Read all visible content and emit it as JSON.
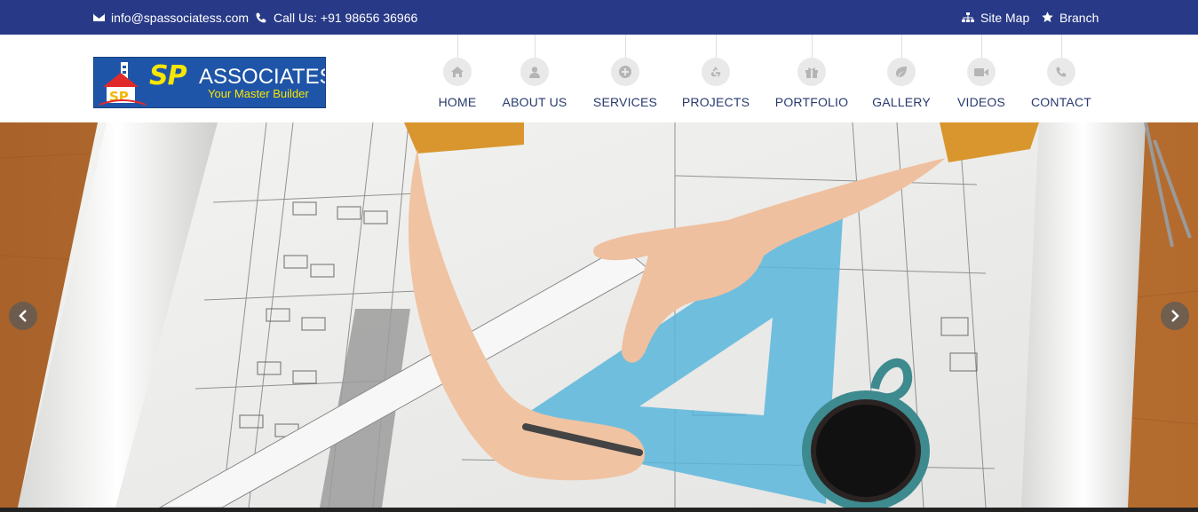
{
  "topbar": {
    "email": "info@spassociatess.com",
    "phone": "Call Us: +91 98656 36966",
    "sitemap": "Site Map",
    "branch": "Branch"
  },
  "logo": {
    "sp": "SP",
    "name": "ASSOCIATES",
    "tagline": "Your Master Builder"
  },
  "nav": {
    "home": "HOME",
    "about": "ABOUT US",
    "services": "SERVICES",
    "projects": "PROJECTS",
    "portfolio": "PORTFOLIO",
    "gallery": "GALLERY",
    "videos": "VIDEOS",
    "contact": "CONTACT"
  },
  "colors": {
    "topbar": "#283a87",
    "nav_text": "#283a6e",
    "logo_bg": "#1f55a8",
    "logo_yellow": "#f7e600"
  }
}
